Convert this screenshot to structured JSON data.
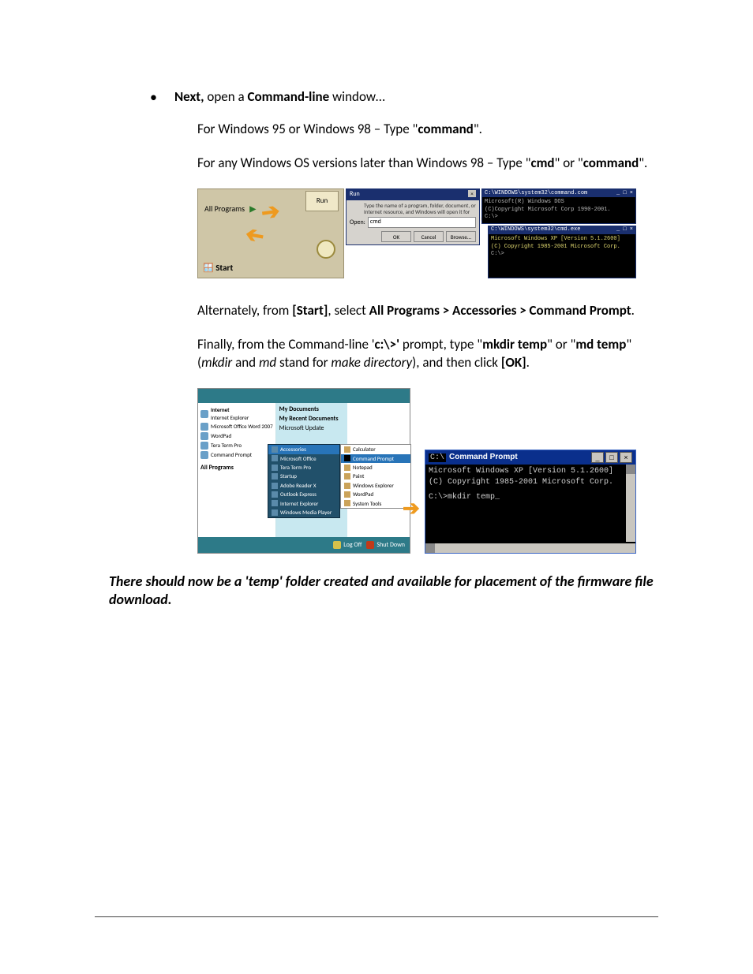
{
  "intro": {
    "bullet_lead": "Next,",
    "bullet_mid": " open a ",
    "bullet_bold": "Command-line",
    "bullet_tail": " window…"
  },
  "p1": {
    "pre": "For Windows 95 or Windows 98 – Type \"",
    "cmd": "command",
    "post": "\"."
  },
  "p2": {
    "pre": "For any Windows OS versions later than Windows 98 – Type \"",
    "cmd1": "cmd",
    "mid": "\" or \"",
    "cmd2": "command",
    "post": "\"."
  },
  "fig1": {
    "all_programs": "All Programs",
    "run_label": "Run",
    "start_label": "Start",
    "run_title": "Run",
    "run_desc": "Type the name of a program, folder, document, or Internet resource, and Windows will open it for you.",
    "open_label": "Open:",
    "open_value": "cmd",
    "btn_ok": "OK",
    "btn_cancel": "Cancel",
    "btn_browse": "Browse...",
    "cmd1_title": "C:\\WINDOWS\\system32\\command.com",
    "cmd1_l1": "Microsoft(R) Windows DOS",
    "cmd1_l2": "(C)Copyright Microsoft Corp 1990-2001.",
    "cmd1_l3": "C:\\>",
    "cmd2_title": "C:\\WINDOWS\\system32\\cmd.exe",
    "cmd2_l1": "Microsoft Windows XP [Version 5.1.2600]",
    "cmd2_l2": "(C) Copyright 1985-2001 Microsoft Corp.",
    "cmd2_l3": "C:\\>"
  },
  "p3_parts": {
    "a": "Alternately, from ",
    "b": "[Start]",
    "c": ", select ",
    "d": "All Programs > Accessories > Command Prompt",
    "e": "."
  },
  "p4_parts": {
    "a": "Finally, from the Command-line '",
    "b": "c:\\>'",
    "c": " prompt, type \"",
    "d": "mkdir temp",
    "e": "\" or \"",
    "f": "md temp",
    "g": "\" (",
    "h": "mkdir",
    "i": " and ",
    "j": "md",
    "k": " stand for ",
    "l": "make directory",
    "m": "), and then click ",
    "n": "[OK]",
    "o": "."
  },
  "fig2": {
    "left_items": {
      "internet": "Internet",
      "internet_sub": "Internet Explorer",
      "word": "Microsoft Office Word 2007",
      "wordpad": "WordPad",
      "teraterm": "Tera Term Pro",
      "cmdpr": "Command Prompt",
      "allprog": "All Programs"
    },
    "mid_items": {
      "mydocs": "My Documents",
      "recent": "My Recent Documents",
      "msupdate": "Microsoft Update"
    },
    "list": {
      "accessories": "Accessories",
      "msoffice": "Microsoft Office",
      "teraterm": "Tera Term Pro",
      "startup": "Startup",
      "adobe": "Adobe Reader X",
      "outlook": "Outlook Express",
      "ie": "Internet Explorer",
      "wmp": "Windows Media Player"
    },
    "sub": {
      "calc": "Calculator",
      "cmd": "Command Prompt",
      "notepad": "Notepad",
      "paint": "Paint",
      "explorer": "Windows Explorer",
      "wordpad": "WordPad",
      "systools": "System Tools"
    },
    "foot": {
      "logoff": "Log Off",
      "shutdown": "Shut Down"
    },
    "cmd_title": "Command Prompt",
    "cmd_l1": "Microsoft Windows XP [Version 5.1.2600]",
    "cmd_l2": "(C) Copyright 1985-2001 Microsoft Corp.",
    "cmd_l3": "C:\\>mkdir temp_"
  },
  "result": "There should now be a 'temp' folder created and available for placement of the firmware file download."
}
